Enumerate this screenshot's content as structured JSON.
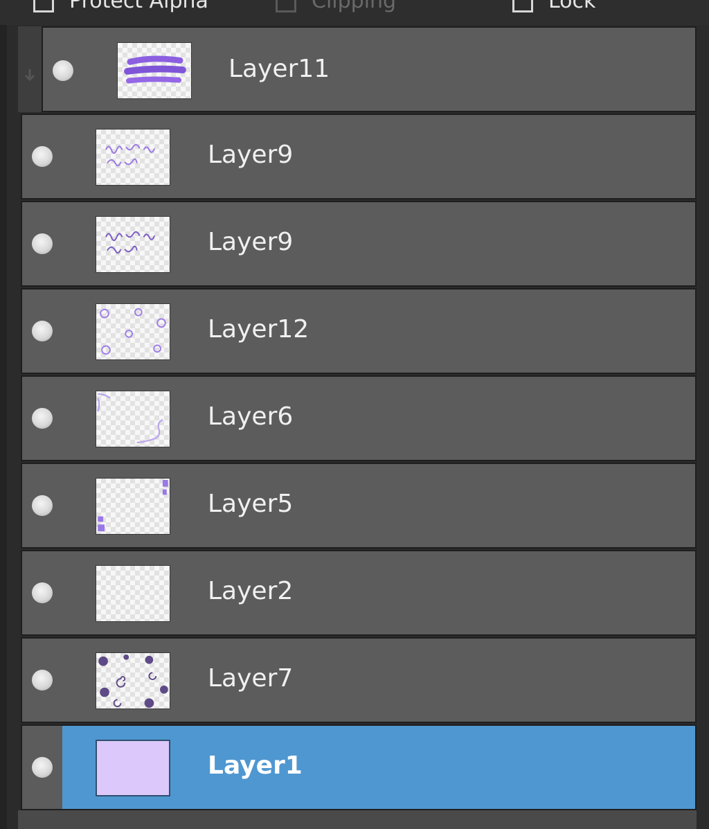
{
  "toolbar": {
    "protect_alpha": "Protect Alpha",
    "clipping": "Clipping",
    "lock": "Lock"
  },
  "layers": [
    {
      "name": "Layer11",
      "clipped": true,
      "visible": true,
      "selected": false,
      "thumb": "purple-brush-strokes"
    },
    {
      "name": "Layer9",
      "clipped": false,
      "visible": true,
      "selected": false,
      "thumb": "purple-lettering"
    },
    {
      "name": "Layer9",
      "clipped": false,
      "visible": true,
      "selected": false,
      "thumb": "purple-lettering"
    },
    {
      "name": "Layer12",
      "clipped": false,
      "visible": true,
      "selected": false,
      "thumb": "scattered-purple-doodles"
    },
    {
      "name": "Layer6",
      "clipped": false,
      "visible": true,
      "selected": false,
      "thumb": "purple-corner-swirls"
    },
    {
      "name": "Layer5",
      "clipped": false,
      "visible": true,
      "selected": false,
      "thumb": "purple-edge-marks"
    },
    {
      "name": "Layer2",
      "clipped": false,
      "visible": true,
      "selected": false,
      "thumb": "empty-transparent"
    },
    {
      "name": "Layer7",
      "clipped": false,
      "visible": true,
      "selected": false,
      "thumb": "dark-purple-dots-spirals"
    },
    {
      "name": "Layer1",
      "clipped": false,
      "visible": true,
      "selected": true,
      "thumb": "solid-lavender"
    }
  ],
  "colors": {
    "panel_bg": "#2b2b2b",
    "row_bg": "#5c5c5c",
    "selected_bg": "#4f97d1",
    "fill_lavender": "#dcc8fb",
    "stroke_purple": "#8b5fe0"
  },
  "icons": {
    "visibility": "visibility-dot-icon",
    "clip": "clip-arrow-icon"
  }
}
